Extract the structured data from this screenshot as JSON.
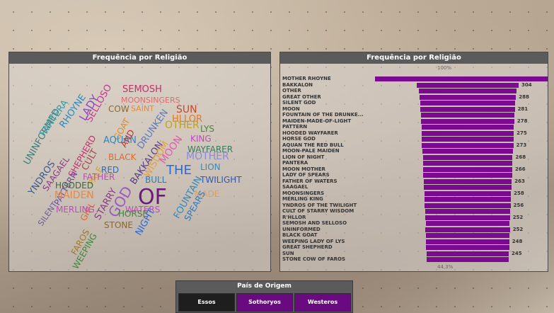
{
  "cloud_panel": {
    "title": "Frequência por Religião"
  },
  "bar_panel": {
    "title": "Frequência por Religião",
    "top_pct": "100%",
    "bottom_pct": "44,3%"
  },
  "word_cloud": {
    "words": [
      {
        "text": "SEMOSH",
        "color": "#c0306a"
      },
      {
        "text": "MOONSINGERS",
        "color": "#e06a6a"
      },
      {
        "text": "SELLOSO",
        "color": "#c03a90"
      },
      {
        "text": "UNINFORMED",
        "color": "#3c7a7a"
      },
      {
        "text": "PANTERA",
        "color": "#2aa0b0"
      },
      {
        "text": "RHOYNE",
        "color": "#2a8ac0"
      },
      {
        "text": "LADY",
        "color": "#8a4ac0"
      },
      {
        "text": "COW",
        "color": "#8a6a2a"
      },
      {
        "text": "SAINT",
        "color": "#e08a4a"
      },
      {
        "text": "SUN",
        "color": "#c04a2a"
      },
      {
        "text": "HLLOR",
        "color": "#e07a2a"
      },
      {
        "text": "YNDROS",
        "color": "#3a5a8a"
      },
      {
        "text": "SAAGAEL",
        "color": "#8a3a8a"
      },
      {
        "text": "SHEPHERD",
        "color": "#c0306a"
      },
      {
        "text": "GOAT",
        "color": "#e08a2a"
      },
      {
        "text": "DRUNKEN",
        "color": "#5a7ac0"
      },
      {
        "text": "OTHER",
        "color": "#c0a020"
      },
      {
        "text": "LYS",
        "color": "#3a8a3a"
      },
      {
        "text": "AQUAN",
        "color": "#2a8ac0"
      },
      {
        "text": "AND",
        "color": "#c03030"
      },
      {
        "text": "KING",
        "color": "#c04ac0"
      },
      {
        "text": "CULT",
        "color": "#a04a4a"
      },
      {
        "text": "PATTERN",
        "color": "#6a4aa0"
      },
      {
        "text": "BLACK",
        "color": "#e06a2a"
      },
      {
        "text": "WAYFARER",
        "color": "#3a7a5a"
      },
      {
        "text": "SILENT",
        "color": "#6a5aa0"
      },
      {
        "text": "PALE",
        "color": "#e0a020"
      },
      {
        "text": "MOON",
        "color": "#e05ab0"
      },
      {
        "text": "MOTHER",
        "color": "#8a8ae0"
      },
      {
        "text": "BAKKALON",
        "color": "#5a3a8a"
      },
      {
        "text": "LION",
        "color": "#3a8ac0"
      },
      {
        "text": "RED",
        "color": "#2a6ac0"
      },
      {
        "text": "WISDOM",
        "color": "#e0a040"
      },
      {
        "text": "THE",
        "color": "#2a6ae0"
      },
      {
        "text": "FATHER",
        "color": "#c04ac0"
      },
      {
        "text": "TWILIGHT",
        "color": "#2a5ac0"
      },
      {
        "text": "GOD",
        "color": "#9a5ac0"
      },
      {
        "text": "BULL",
        "color": "#2a7ac0"
      },
      {
        "text": "HOODED",
        "color": "#3a6a3a"
      },
      {
        "text": "OF",
        "color": "#6a1a7a"
      },
      {
        "text": "MAIDEN",
        "color": "#e08a4a"
      },
      {
        "text": "STARRY",
        "color": "#8a3a8a"
      },
      {
        "text": "FOUNTAIN",
        "color": "#2a8ac0"
      },
      {
        "text": "MADE",
        "color": "#e0a060"
      },
      {
        "text": "GIRL",
        "color": "#e06a2a"
      },
      {
        "text": "SPEARS",
        "color": "#2a7ac0"
      },
      {
        "text": "WATERS",
        "color": "#c04ac0"
      },
      {
        "text": "MERLING",
        "color": "#c04ac0"
      },
      {
        "text": "HORSE",
        "color": "#3a8a3a"
      },
      {
        "text": "FAROS",
        "color": "#a07a2a"
      },
      {
        "text": "NIGHT",
        "color": "#2a6ae0"
      },
      {
        "text": "WEEPING",
        "color": "#3a8a3a"
      },
      {
        "text": "STONE",
        "color": "#8a6a2a"
      }
    ]
  },
  "chart_data": {
    "type": "bar",
    "title": "Frequência por Religião",
    "categories": [
      "MOTHER RHOYNE",
      "BAKKALON",
      "OTHER",
      "GREAT OTHER",
      "SILENT GOD",
      "MOON",
      "FOUNTAIN OF THE DRUNKE...",
      "MAIDEN-MADE-OF-LIGHT",
      "PATTERN",
      "HOODED WAYFARER",
      "HORSE GOD",
      "AQUAN THE RED BULL",
      "MOON-PALE MAIDEN",
      "LION OF NIGHT",
      "PANTERA",
      "MOON MOTHER",
      "LADY OF SPEARS",
      "FATHER OF WATERS",
      "SAAGAEL",
      "MOONSINGERS",
      "MERLING KING",
      "YNDROS OF THE TWILIGHT",
      "CULT OF STARRY WISDOM",
      "R'HLLOR",
      "SEMOSH AND SELLOSO",
      "UNINFORMED",
      "BLACK GOAT",
      "WEEPING LADY OF LYS",
      "GREAT SHEPHERD",
      "SUN",
      "STONE COW OF FAROS"
    ],
    "values": [
      553,
      304,
      291,
      288,
      283,
      281,
      280,
      278,
      276,
      275,
      274,
      273,
      271,
      268,
      267,
      266,
      265,
      263,
      261,
      258,
      257,
      256,
      254,
      252,
      251,
      252,
      250,
      248,
      247,
      245,
      245
    ],
    "shown_labels": [
      "304",
      "288",
      "281",
      "278",
      "275",
      "273",
      "268",
      "266",
      "263",
      "258",
      "256",
      "252",
      "252",
      "248",
      "245"
    ],
    "top_label": "100%",
    "bottom_label": "44,3%",
    "bar_color": "#7a0a8e"
  },
  "slicer": {
    "title": "País de Origem",
    "options": [
      {
        "label": "Essos",
        "selected": false,
        "color": "#1e1e1e"
      },
      {
        "label": "Sothoryos",
        "selected": true,
        "color": "#6a0a80"
      },
      {
        "label": "Westeros",
        "selected": true,
        "color": "#6a0a80"
      }
    ]
  }
}
